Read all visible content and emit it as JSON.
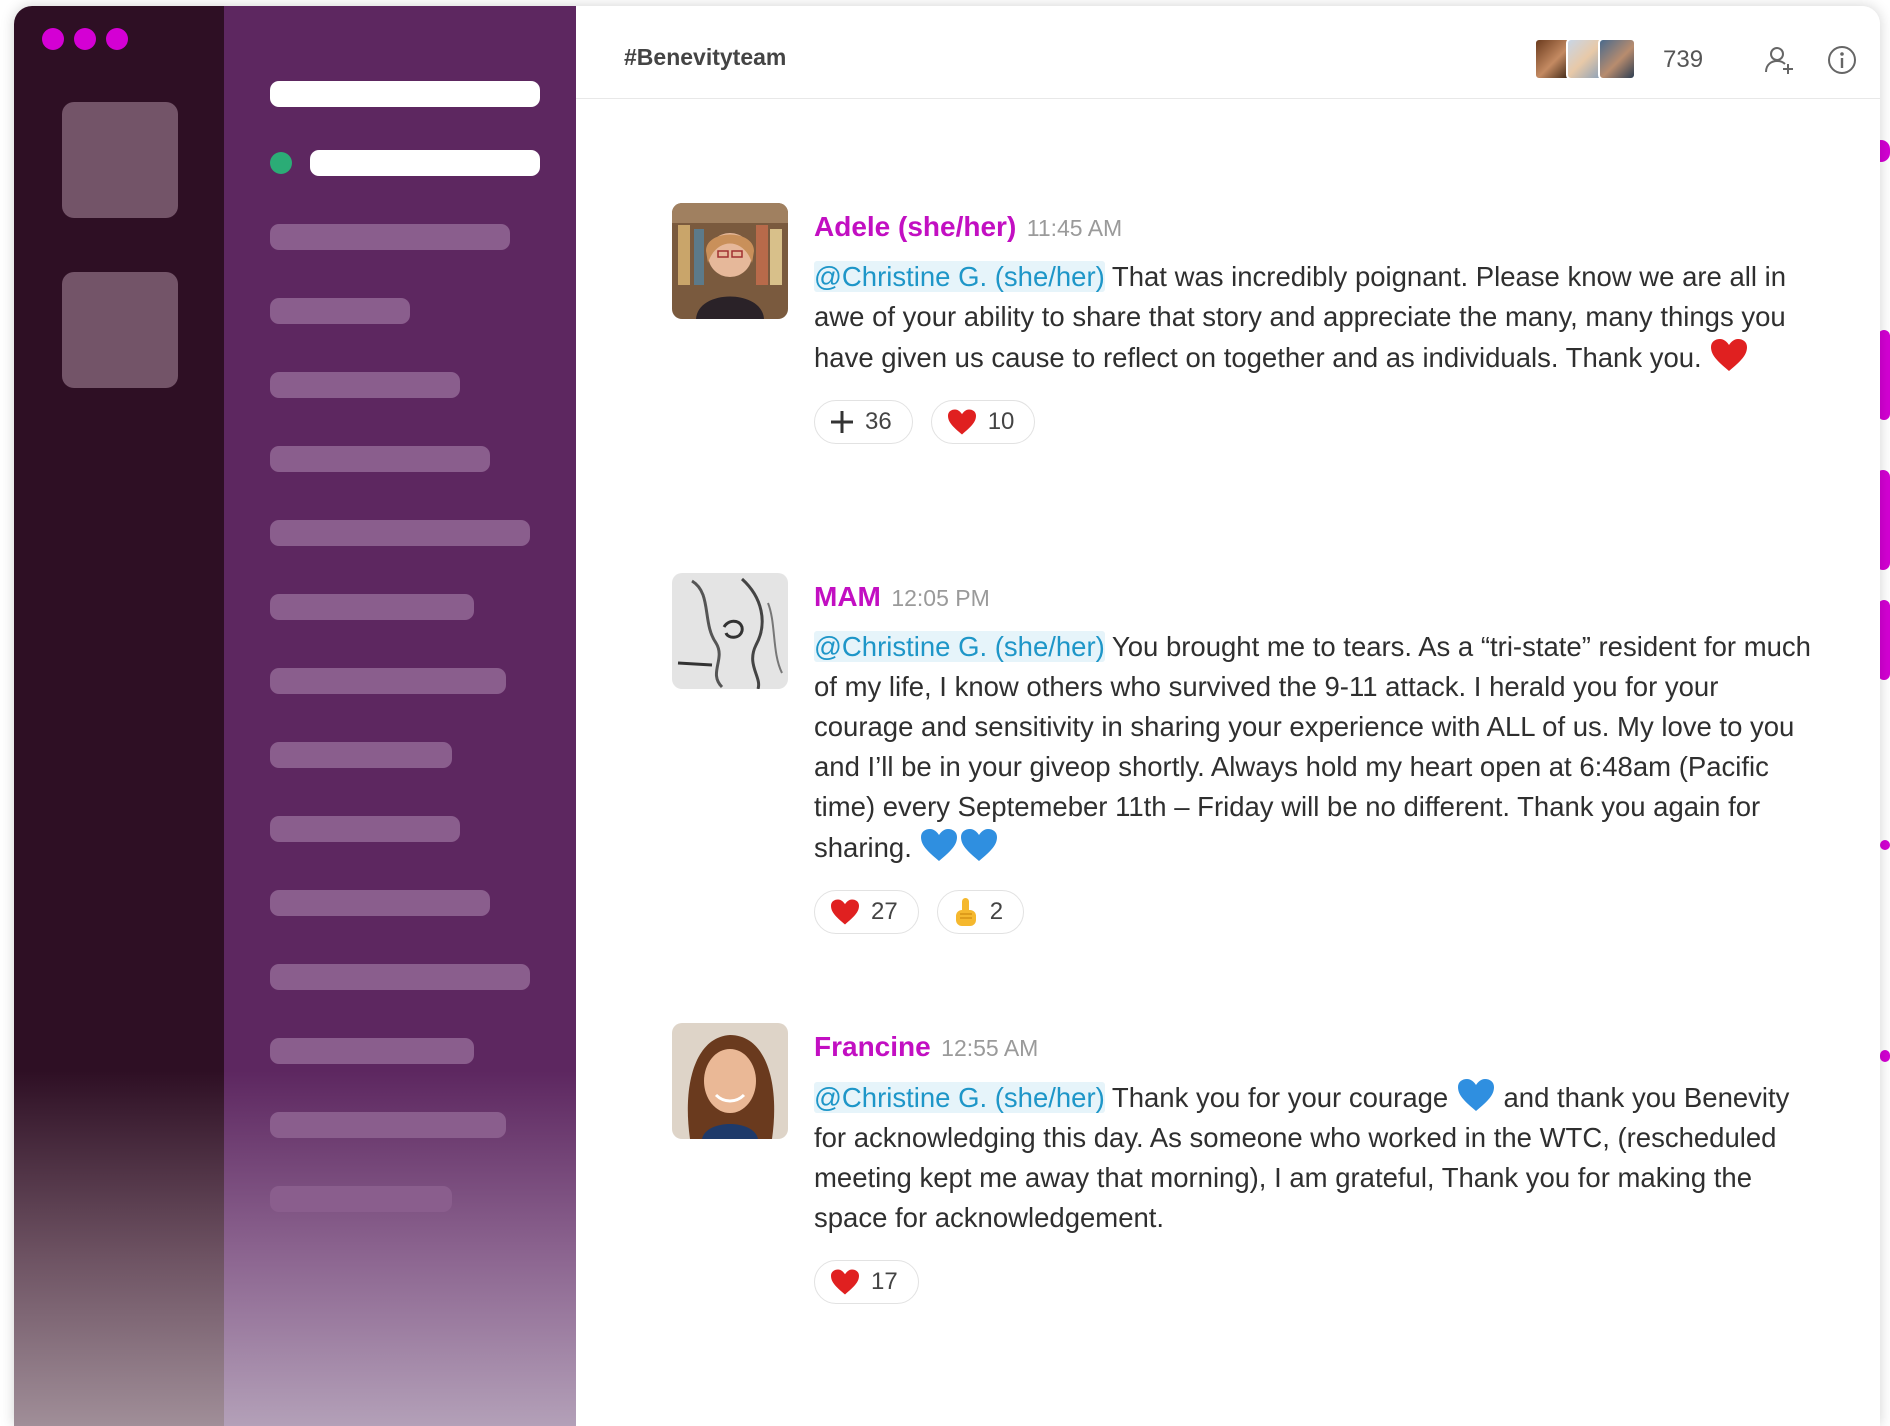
{
  "colors": {
    "accent": "#d400d4",
    "rail": "#2e0f24",
    "sidebar": "#5d2760",
    "author": "#c20fc2",
    "mention": "#1e96c8",
    "online": "#2bac76"
  },
  "header": {
    "channel": "#Benevityteam",
    "member_count": "739",
    "icons": [
      "add-member-icon",
      "info-icon"
    ]
  },
  "messages": [
    {
      "author": "Adele (she/her)",
      "time": "11:45 AM",
      "mention": "@Christine G. (she/her)",
      "text": " That was incredibly poignant. Please know we are all in awe of your ability to share that story and appreciate the many, many things you have given us cause to reflect on together and as individuals. Thank you. ",
      "inline_emoji": [
        "red-heart"
      ],
      "reactions": [
        {
          "emoji": "plus-sign",
          "count": "36"
        },
        {
          "emoji": "red-heart",
          "count": "10"
        }
      ]
    },
    {
      "author": "MAM",
      "time": "12:05 PM",
      "mention": "@Christine G. (she/her)",
      "text": " You brought me to tears. As a “tri-state” resident for much of my life, I know others who survived the 9-11 attack. I herald you for your courage and sensitivity in sharing your experience with ALL of us. My love to you and I’ll be in your giveop shortly. Always hold my heart open at 6:48am (Pacific time) every Septemeber 11th – Friday will be no different. Thank you again for sharing. ",
      "inline_emoji": [
        "blue-heart",
        "blue-heart"
      ],
      "reactions": [
        {
          "emoji": "red-heart",
          "count": "27"
        },
        {
          "emoji": "pointing-up-hand",
          "count": "2"
        }
      ]
    },
    {
      "author": "Francine",
      "time": "12:55 AM",
      "mention": "@Christine G. (she/her)",
      "text_before": " Thank you for your courage ",
      "inline_emoji": [
        "blue-heart"
      ],
      "text_after": " and thank you Benevity for acknowledging this day. As someone who worked in the WTC, (rescheduled meeting kept me away that morning), I am grateful, Thank you for making the space for acknowledgement.",
      "reactions": [
        {
          "emoji": "red-heart",
          "count": "17"
        }
      ]
    }
  ]
}
